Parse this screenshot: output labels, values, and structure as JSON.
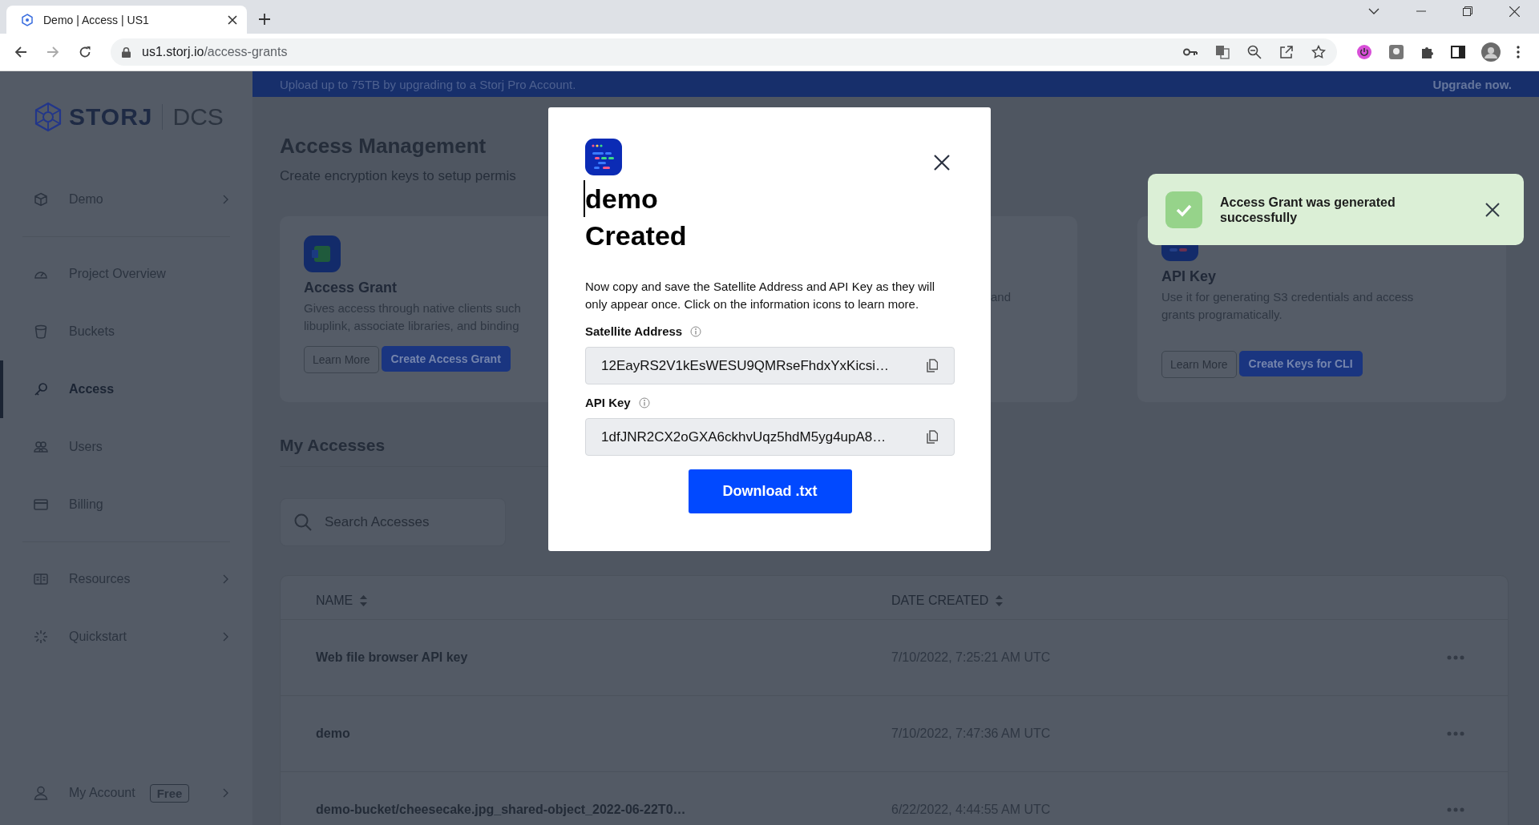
{
  "browser": {
    "tab_title": "Demo | Access | US1",
    "url_host": "us1.storj.io",
    "url_path": "/access-grants"
  },
  "banner": {
    "text": "Upload up to 75TB by upgrading to a Storj Pro Account.",
    "link": "Upgrade now."
  },
  "sidebar": {
    "logo": {
      "brand": "STORJ",
      "product": "DCS"
    },
    "sections": [
      {
        "items": [
          {
            "label": "Demo",
            "selected": false,
            "expandable": true
          }
        ]
      },
      {
        "items": [
          {
            "label": "Project Overview",
            "selected": false,
            "expandable": false
          },
          {
            "label": "Buckets",
            "selected": false,
            "expandable": false
          },
          {
            "label": "Access",
            "selected": true,
            "expandable": false
          },
          {
            "label": "Users",
            "selected": false,
            "expandable": false
          },
          {
            "label": "Billing",
            "selected": false,
            "expandable": false
          }
        ]
      },
      {
        "items": [
          {
            "label": "Resources",
            "selected": false,
            "expandable": true
          },
          {
            "label": "Quickstart",
            "selected": false,
            "expandable": true
          }
        ]
      }
    ],
    "account": {
      "label": "My Account",
      "badge": "Free",
      "expandable": true
    }
  },
  "page": {
    "title": "Access Management",
    "subtitle": "Create encryption keys to setup permis",
    "cards": [
      {
        "kind": "access-grant",
        "title": "Access Grant",
        "lines": [
          "Gives access through native clients such",
          "libuplink, associate libraries, and binding"
        ],
        "buttons": [
          "Learn More",
          "Create Access Grant"
        ]
      },
      {
        "kind": "partial",
        "lines": [
          "and"
        ]
      },
      {
        "kind": "api-key",
        "title": "API Key",
        "lines": [
          "Use it for generating S3 credentials and access",
          "grants programatically."
        ],
        "buttons": [
          "Learn More",
          "Create Keys for CLI"
        ]
      }
    ],
    "my_accesses": {
      "title": "My Accesses",
      "search": {
        "placeholder": "Search Accesses"
      },
      "table": {
        "columns": [
          "NAME",
          "DATE CREATED"
        ],
        "rows": [
          {
            "name": "Web file browser API key",
            "date": "7/10/2022, 7:25:21 AM UTC"
          },
          {
            "name": "demo",
            "date": "7/10/2022, 7:47:36 AM UTC"
          },
          {
            "name": "demo-bucket/cheesecake.jpg_shared-object_2022-06-22T0…",
            "date": "6/22/2022, 4:44:55 AM UTC"
          }
        ]
      }
    }
  },
  "modal": {
    "title_lines": [
      "demo",
      "Created"
    ],
    "message": "Now copy and save the Satellite Address and API Key as they will only appear once. Click on the information icons to learn more.",
    "fields": [
      {
        "label": "Satellite Address",
        "value": "12EayRS2V1kEsWESU9QMRseFhdxYxKicsi…"
      },
      {
        "label": "API Key",
        "value": "1dfJNR2CX2oGXA6ckhvUqz5hdM5yg4upA8…"
      }
    ],
    "button": "Download .txt"
  },
  "toast": {
    "message": "Access Grant was generated successfully"
  }
}
